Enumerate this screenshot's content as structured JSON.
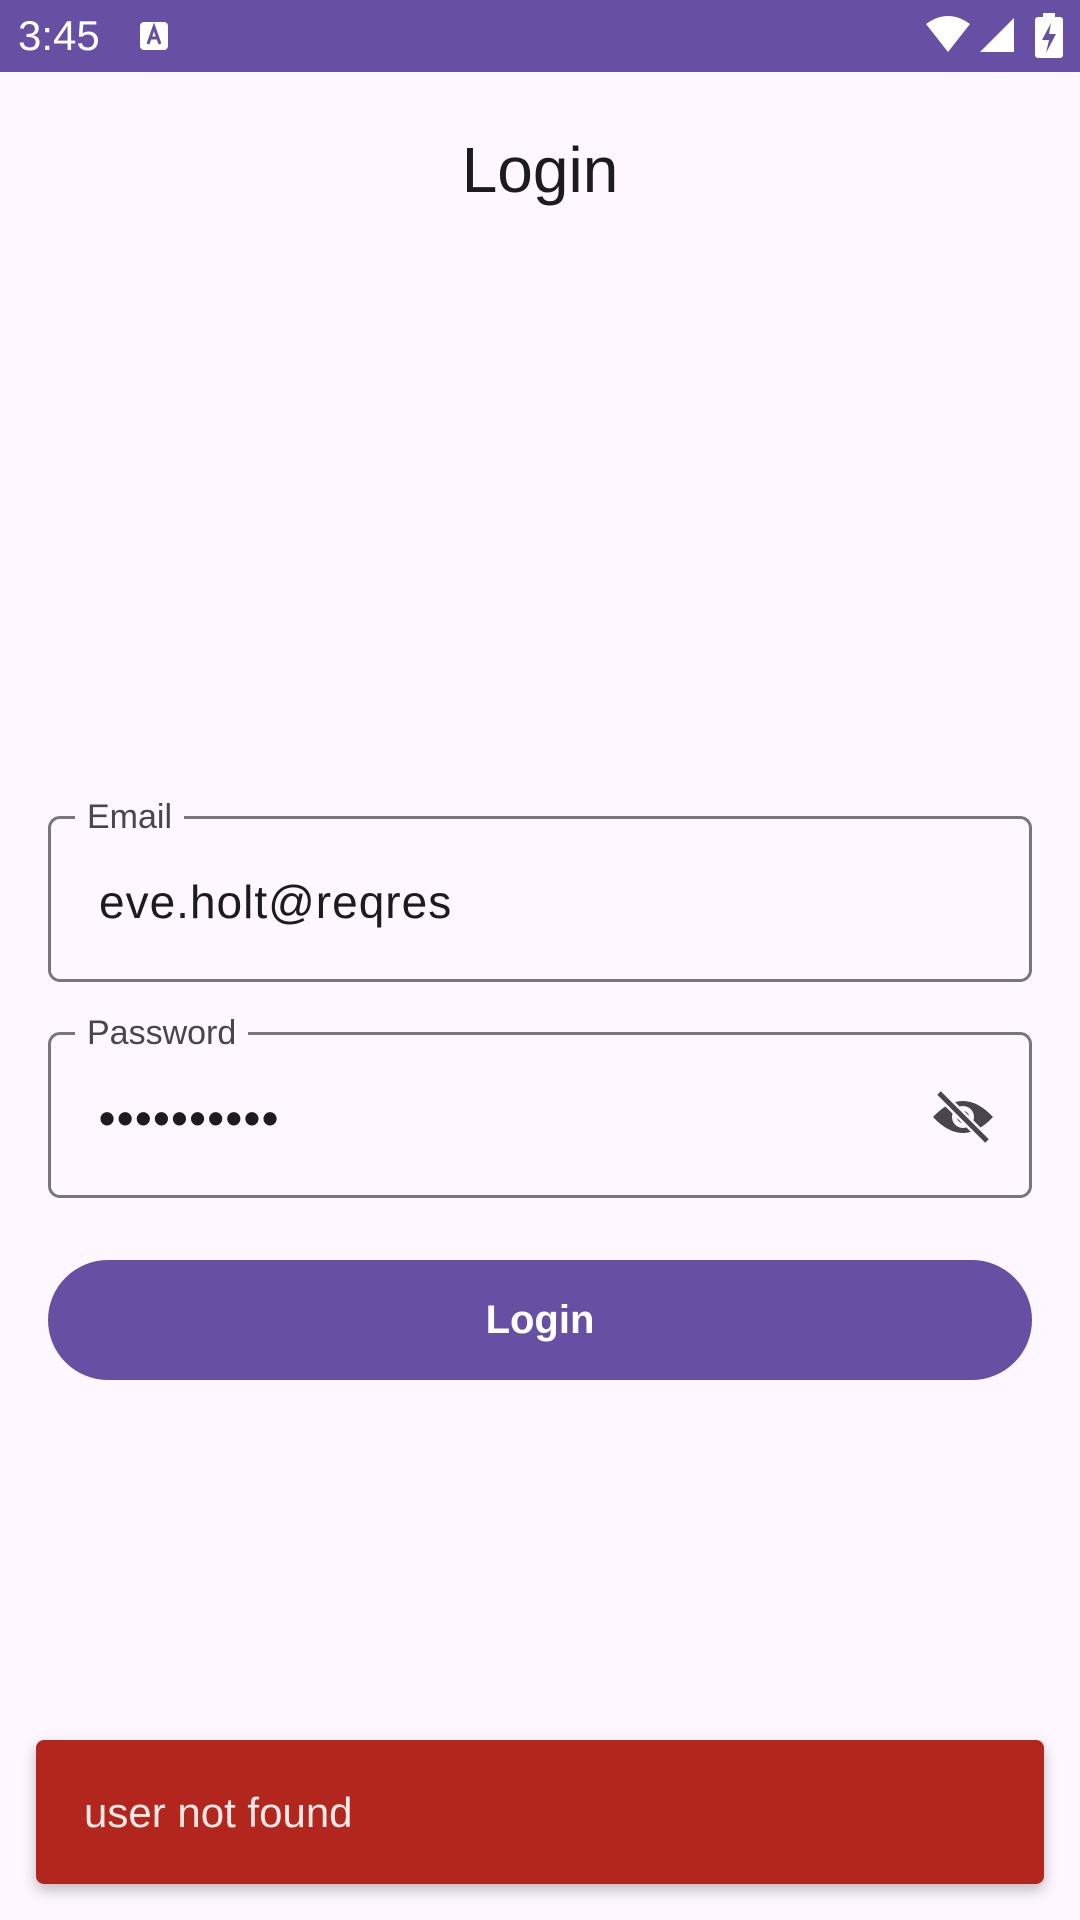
{
  "status_bar": {
    "time": "3:45",
    "app_icon": "text-a-icon",
    "wifi_icon": "wifi-icon",
    "signal_icon": "signal-icon",
    "battery_icon": "battery-charging-icon"
  },
  "page": {
    "title": "Login"
  },
  "email_field": {
    "label": "Email",
    "value": "eve.holt@reqres"
  },
  "password_field": {
    "label": "Password",
    "value": "••••••••••",
    "toggle_icon": "visibility-off-icon"
  },
  "login_button": {
    "label": "Login"
  },
  "snackbar": {
    "message": "user not found"
  },
  "colors": {
    "primary": "#6750A4",
    "background": "#FEF7FF",
    "error": "#B3261E",
    "outline": "#79747E"
  }
}
